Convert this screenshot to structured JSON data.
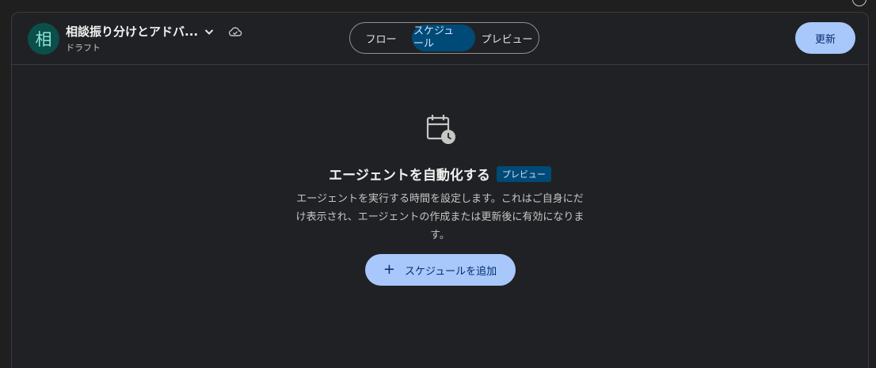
{
  "header": {
    "avatar_initial": "相",
    "agent_title": "相談振り分けとアドバ...",
    "status": "ドラフト",
    "tabs": [
      "フロー",
      "スケジュール",
      "プレビュー"
    ],
    "active_tab": "スケジュール",
    "update_label": "更新"
  },
  "main": {
    "title": "エージェントを自動化する",
    "badge": "プレビュー",
    "description": "エージェントを実行する時間を設定します。これはご自身にだけ表示され、エージェントの作成または更新後に有効になります。",
    "add_button_label": "スケジュールを追加",
    "icon": "calendar-clock-icon"
  },
  "colors": {
    "background": "#202124",
    "accent_button": "#a8c7fa",
    "active_tab": "#004a77",
    "avatar_bg": "#0b4f4a"
  }
}
